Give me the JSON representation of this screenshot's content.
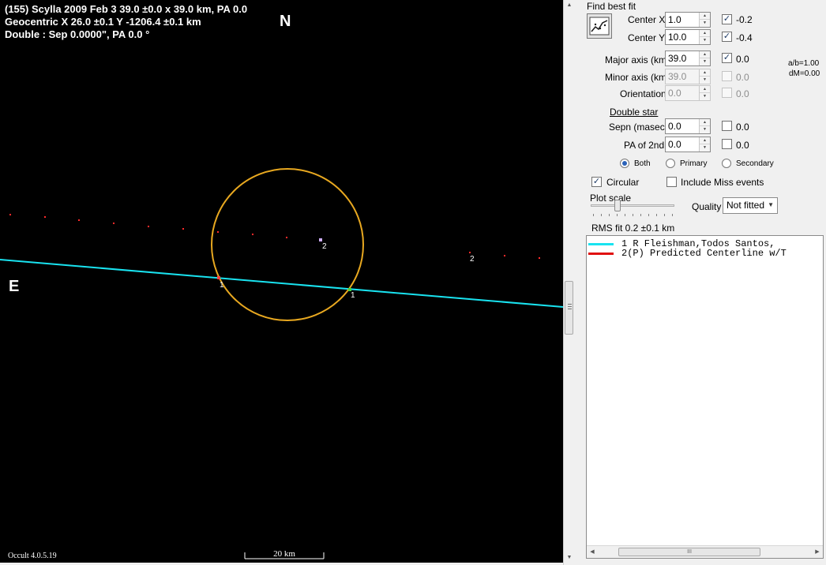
{
  "plot": {
    "header": [
      "(155) Scylla  2009 Feb 3   39.0 ±0.0 x 39.0 km,  PA 0.0",
      "Geocentric  X  26.0 ±0.1   Y -1206.4 ±0.1 km",
      "Double : Sep  0.0000\",  PA 0.0 °"
    ],
    "compass_north": "N",
    "compass_east": "E",
    "chord_labels": {
      "chord1_a": "1",
      "chord1_b": "1",
      "pred_a": "2",
      "pred_b": "2"
    },
    "scale_label": "20 km",
    "version": "Occult 4.0.5.19",
    "colors": {
      "background": "#000000",
      "ellipse": "#e8a820",
      "observed_chord": "#19e3f0",
      "predicted_dots": "#ff2a2a"
    }
  },
  "panel": {
    "find_best_fit_title": "Find best fit",
    "fit_button_icon": "fit-graph-icon",
    "fields": {
      "center_x": {
        "label": "Center X",
        "value": "1.0",
        "checked": true,
        "result": "-0.2"
      },
      "center_y": {
        "label": "Center Y",
        "value": "10.0",
        "checked": true,
        "result": "-0.4"
      },
      "major_axis": {
        "label": "Major axis (km)",
        "value": "39.0",
        "checked": true,
        "result": "0.0"
      },
      "minor_axis": {
        "label": "Minor axis (km)",
        "value": "39.0",
        "checked": false,
        "result": "0.0"
      },
      "orientation": {
        "label": "Orientation",
        "value": "0.0",
        "checked": false,
        "result": "0.0"
      },
      "sepn": {
        "label": "Sepn (masec)",
        "value": "0.0",
        "checked": false,
        "result": "0.0"
      },
      "pa_2nd": {
        "label": "PA of 2nd",
        "value": "0.0",
        "checked": false,
        "result": "0.0"
      }
    },
    "ab_ratio": "a/b=1.00",
    "dm": "dM=0.00",
    "double_star_heading": "Double star",
    "radios": {
      "both": "Both",
      "primary": "Primary",
      "secondary": "Secondary",
      "selected": "both"
    },
    "circular_label": "Circular",
    "circular_checked": true,
    "include_miss_label": "Include Miss events",
    "include_miss_checked": false,
    "plot_scale_label": "Plot scale",
    "quality_label": "Quality",
    "quality_value": "Not fitted",
    "rms_fit": "RMS fit 0.2 ±0.1 km",
    "list": [
      {
        "text": "1     R Fleishman,Todos Santos,",
        "color": "#19e3f0"
      },
      {
        "text": "2(P)  Predicted Centerline w/T",
        "color": "#e01010"
      }
    ],
    "hscroll_grip": "III"
  }
}
